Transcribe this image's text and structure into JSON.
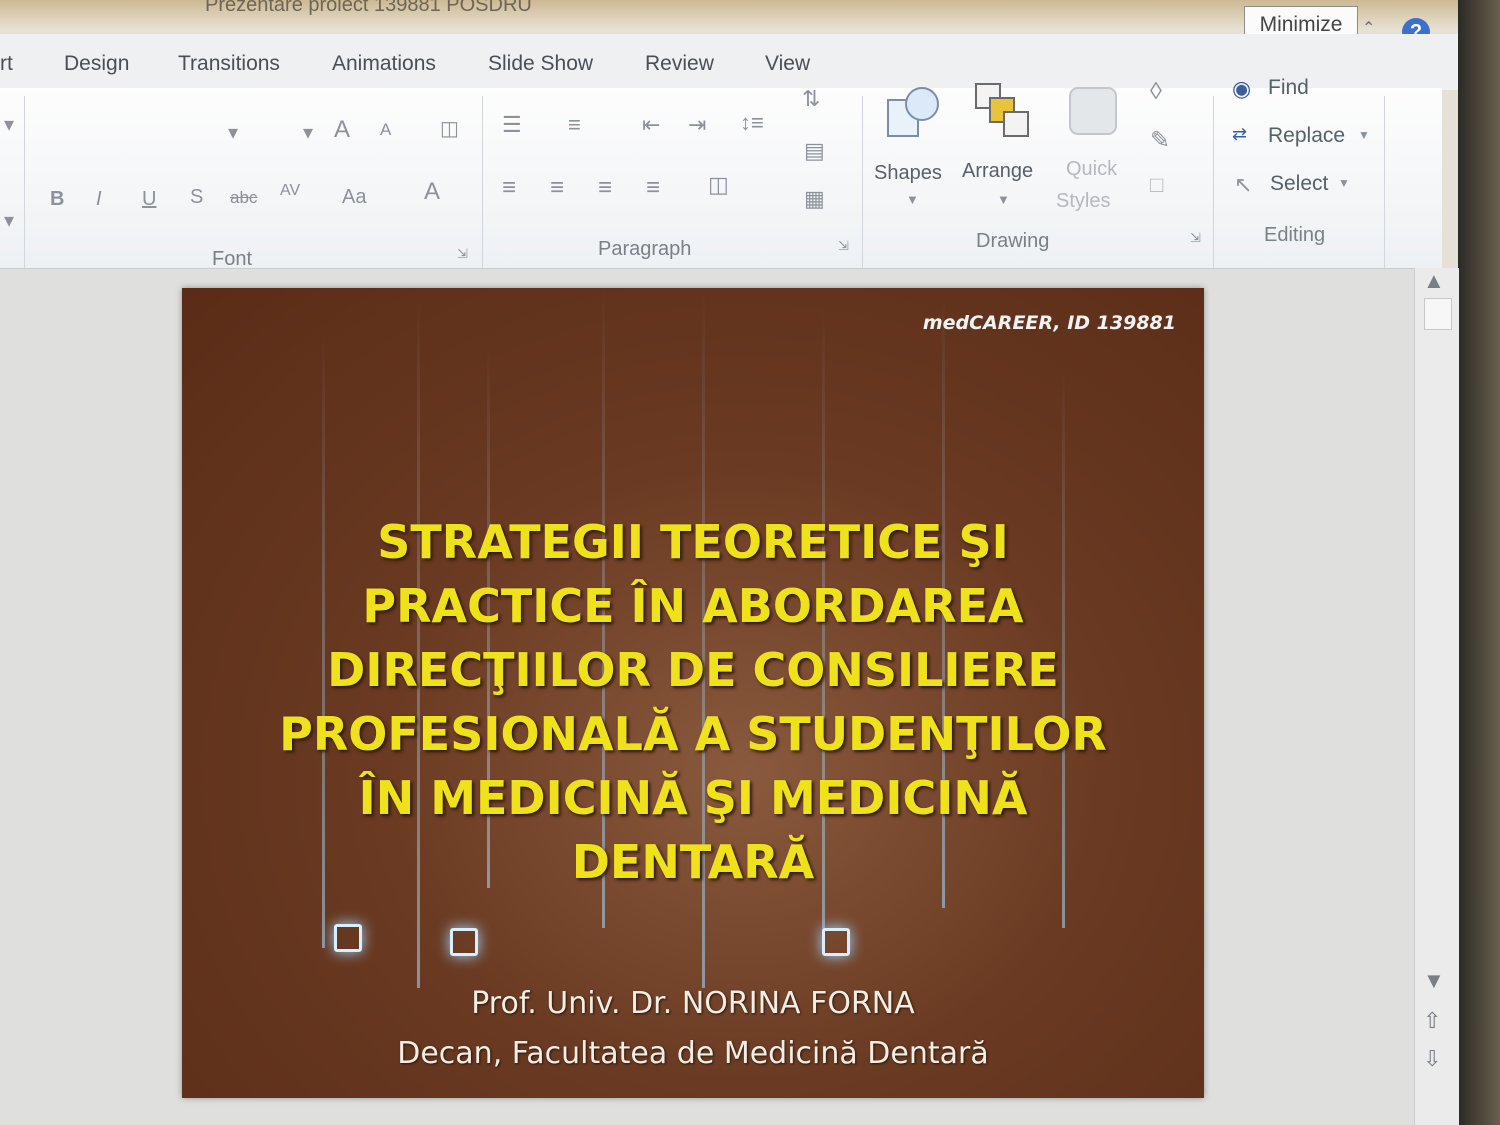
{
  "window": {
    "doc_title": "Prezentare proiect 139881 POSDRU",
    "minimize_tooltip": "Minimize",
    "help_icon": "?"
  },
  "tabs": [
    "rt",
    "Design",
    "Transitions",
    "Animations",
    "Slide Show",
    "Review",
    "View"
  ],
  "ribbon": {
    "font_group": "Font",
    "paragraph_group": "Paragraph",
    "drawing_group": "Drawing",
    "editing_group": "Editing",
    "shapes": "Shapes",
    "arrange": "Arrange",
    "quick": "Quick",
    "styles": "Styles",
    "find": "Find",
    "replace": "Replace",
    "select": "Select",
    "font_buttons": {
      "bold": "B",
      "italic": "I",
      "underline": "U",
      "shadow": "S",
      "strike": "abc",
      "spacing": "AV",
      "case": "Aa",
      "color": "A",
      "grow": "A",
      "shrink": "A"
    }
  },
  "slide": {
    "tag": "medCAREER, ID 139881",
    "title_lines": [
      "STRATEGII TEORETICE ŞI",
      "PRACTICE ÎN ABORDAREA",
      "DIRECŢIILOR DE CONSILIERE",
      "PROFESIONALĂ A STUDENŢILOR",
      "ÎN MEDICINĂ ŞI MEDICINĂ",
      "DENTARĂ"
    ],
    "author": "Prof. Univ. Dr. NORINA FORNA",
    "role": "Decan, Facultatea de Medicină Dentară"
  },
  "colors": {
    "title_yellow": "#efe21b",
    "slide_bg": "#6a3a22",
    "help_blue": "#3d6fcf"
  }
}
